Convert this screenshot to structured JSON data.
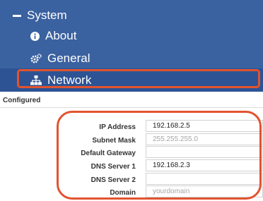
{
  "sidebar": {
    "system_label": "System",
    "items": [
      {
        "label": "About",
        "icon": "info-circle-icon"
      },
      {
        "label": "General",
        "icon": "cogs-icon"
      },
      {
        "label": "Network",
        "icon": "sitemap-icon"
      }
    ],
    "active_item": "Network"
  },
  "main": {
    "section_title": "Configured",
    "fields": [
      {
        "label": "IP Address",
        "value": "192.168.2.5",
        "placeholder": ""
      },
      {
        "label": "Subnet Mask",
        "value": "",
        "placeholder": "255.255.255.0"
      },
      {
        "label": "Default Gateway",
        "value": "",
        "placeholder": ""
      },
      {
        "label": "DNS Server 1",
        "value": "192.168.2.3",
        "placeholder": ""
      },
      {
        "label": "DNS Server 2",
        "value": "",
        "placeholder": ""
      },
      {
        "label": "Domain",
        "value": "",
        "placeholder": "yourdomain"
      }
    ]
  },
  "colors": {
    "sidebar_bg": "#3a61a0",
    "active_bg": "#2d5394",
    "highlight": "#e2532f"
  }
}
